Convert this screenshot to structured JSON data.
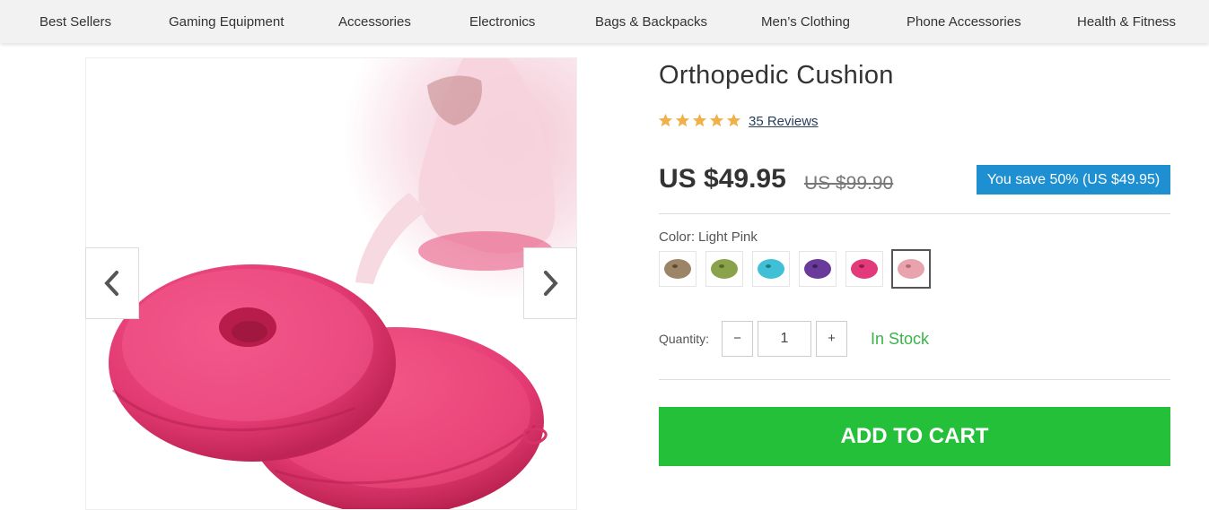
{
  "nav": {
    "items": [
      {
        "label": "Best Sellers"
      },
      {
        "label": "Gaming Equipment"
      },
      {
        "label": "Accessories"
      },
      {
        "label": "Electronics"
      },
      {
        "label": "Bags & Backpacks"
      },
      {
        "label": "Men’s Clothing"
      },
      {
        "label": "Phone Accessories"
      },
      {
        "label": "Health & Fitness"
      }
    ]
  },
  "product": {
    "title": "Orthopedic Cushion",
    "rating": 5,
    "reviews_label": "35 Reviews",
    "price": "US $49.95",
    "old_price": "US $99.90",
    "save_label": "You save 50% (US $49.95)",
    "color_label": "Color:",
    "color_value": "Light Pink",
    "colors": [
      {
        "name": "khaki",
        "hex": "#9c8466"
      },
      {
        "name": "olive",
        "hex": "#8aa34a"
      },
      {
        "name": "sky-blue",
        "hex": "#3fc0d6"
      },
      {
        "name": "purple",
        "hex": "#6a3a9a"
      },
      {
        "name": "rose",
        "hex": "#e23a7a"
      },
      {
        "name": "light-pink",
        "hex": "#e8a3ad"
      }
    ],
    "selected_color_index": 5,
    "quantity_label": "Quantity:",
    "quantity_value": "1",
    "decrement_label": "−",
    "increment_label": "+",
    "stock_label": "In Stock",
    "add_to_cart_label": "ADD TO CART"
  },
  "colors": {
    "accent_blue": "#1e90d1",
    "cta_green": "#25c03a",
    "stock_green": "#3ab34a",
    "star": "#f0b04a"
  },
  "icons": {
    "prev": "chevron-left-icon",
    "next": "chevron-right-icon",
    "star": "star-icon"
  }
}
